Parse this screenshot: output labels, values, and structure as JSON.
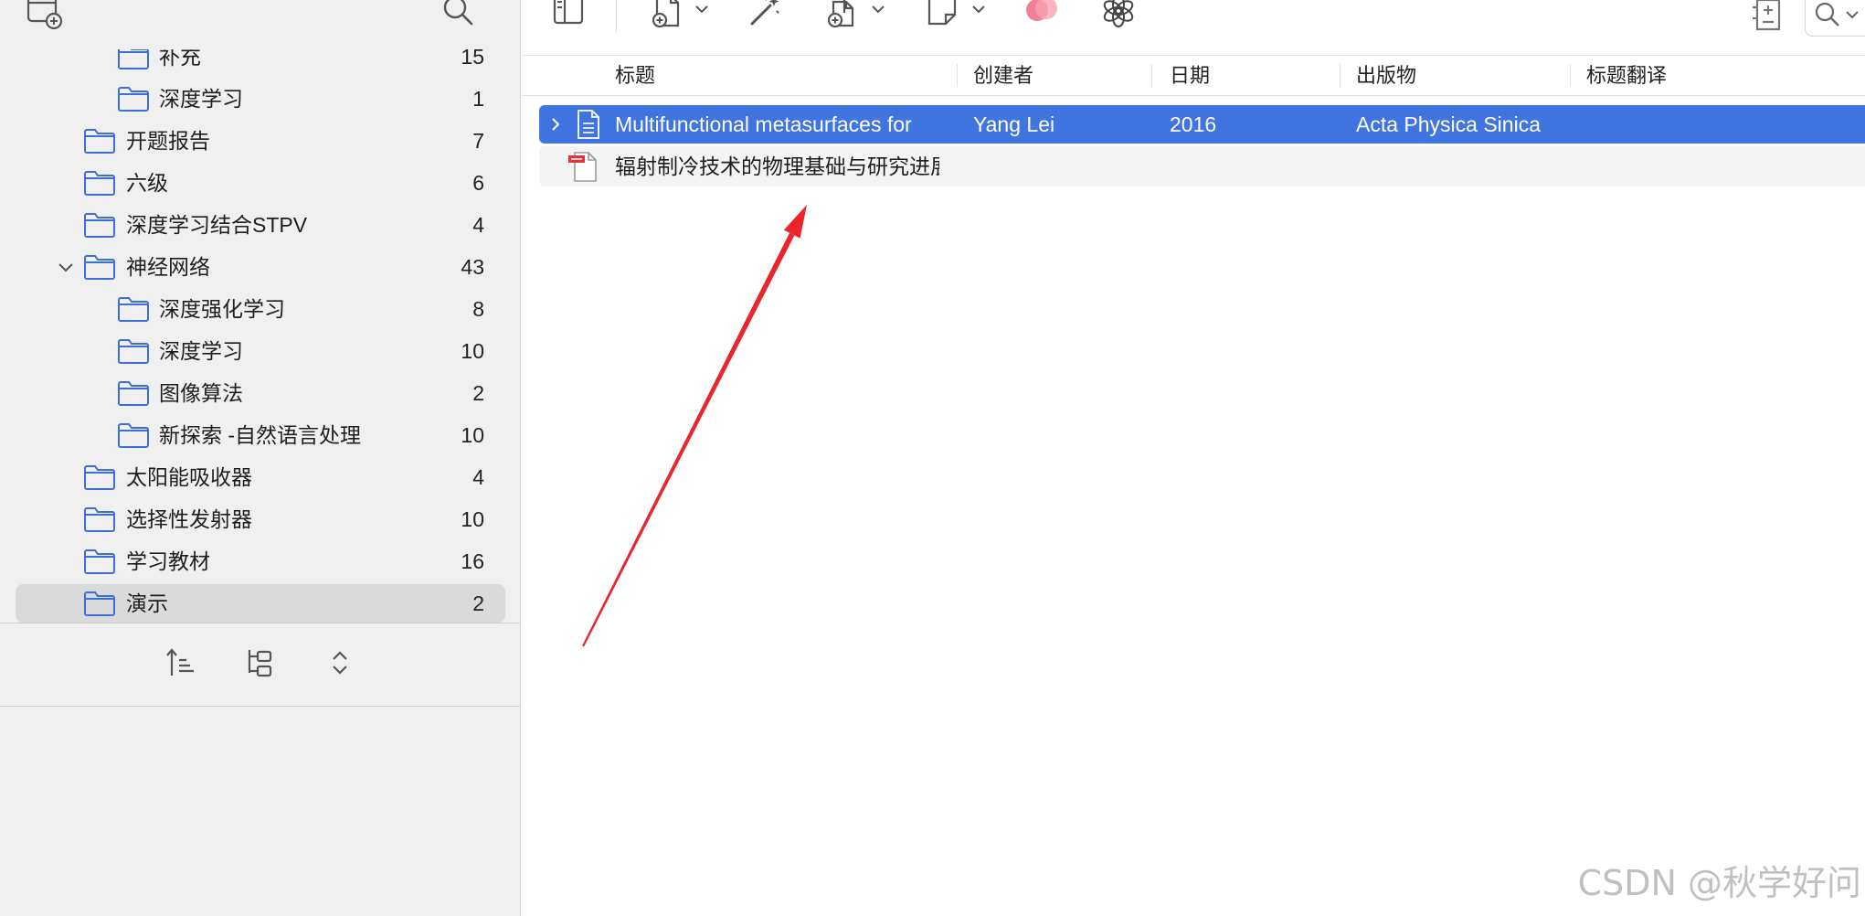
{
  "colors": {
    "accent": "#4074e0",
    "folder": "#3d6fd8",
    "sidebar_bg": "#f0f0f0",
    "sidebar_selected": "#dadada",
    "annotation_arrow": "#e8262b"
  },
  "sidebar": {
    "toolbar_icons": [
      "new-collection-icon",
      "search-icon"
    ],
    "collections": [
      {
        "label": "补充",
        "count": 15,
        "level": 2
      },
      {
        "label": "深度学习",
        "count": 1,
        "level": 2
      },
      {
        "label": "开题报告",
        "count": 7,
        "level": 1
      },
      {
        "label": "六级",
        "count": 6,
        "level": 1
      },
      {
        "label": "深度学习结合STPV",
        "count": 4,
        "level": 1
      },
      {
        "label": "神经网络",
        "count": 43,
        "level": 1,
        "expanded": true
      },
      {
        "label": "深度强化学习",
        "count": 8,
        "level": 2
      },
      {
        "label": "深度学习",
        "count": 10,
        "level": 2
      },
      {
        "label": "图像算法",
        "count": 2,
        "level": 2
      },
      {
        "label": "新探索 -自然语言处理",
        "count": 10,
        "level": 2
      },
      {
        "label": "太阳能吸收器",
        "count": 4,
        "level": 1
      },
      {
        "label": "选择性发射器",
        "count": 10,
        "level": 1
      },
      {
        "label": "学习教材",
        "count": 16,
        "level": 1
      },
      {
        "label": "演示",
        "count": 2,
        "level": 1,
        "selected": true
      }
    ],
    "bottom_toolbar_icons": [
      "sort-icon",
      "collection-tree-icon",
      "expand-collapse-icon"
    ]
  },
  "toolbar": {
    "icons": [
      "reading-pane-icon",
      "new-item-icon",
      "magic-wand-icon",
      "add-attachment-icon",
      "new-note-icon",
      "plugin-icon",
      "openai-icon",
      "add-note-icon",
      "search-icon"
    ]
  },
  "items_table": {
    "columns": [
      "标题",
      "创建者",
      "日期",
      "出版物",
      "标题翻译"
    ],
    "rows": [
      {
        "title": "Multifunctional metasurfaces for",
        "creator": "Yang Lei",
        "date": "2016",
        "publication": "Acta Physica Sinica",
        "translated_title": "",
        "icon": "document-icon",
        "selected": true
      },
      {
        "title": "辐射制冷技术的物理基础与研究进展",
        "creator": "",
        "date": "",
        "publication": "",
        "translated_title": "",
        "icon": "pdf-icon",
        "selected": false
      }
    ]
  },
  "watermark": "CSDN @秋学好问"
}
